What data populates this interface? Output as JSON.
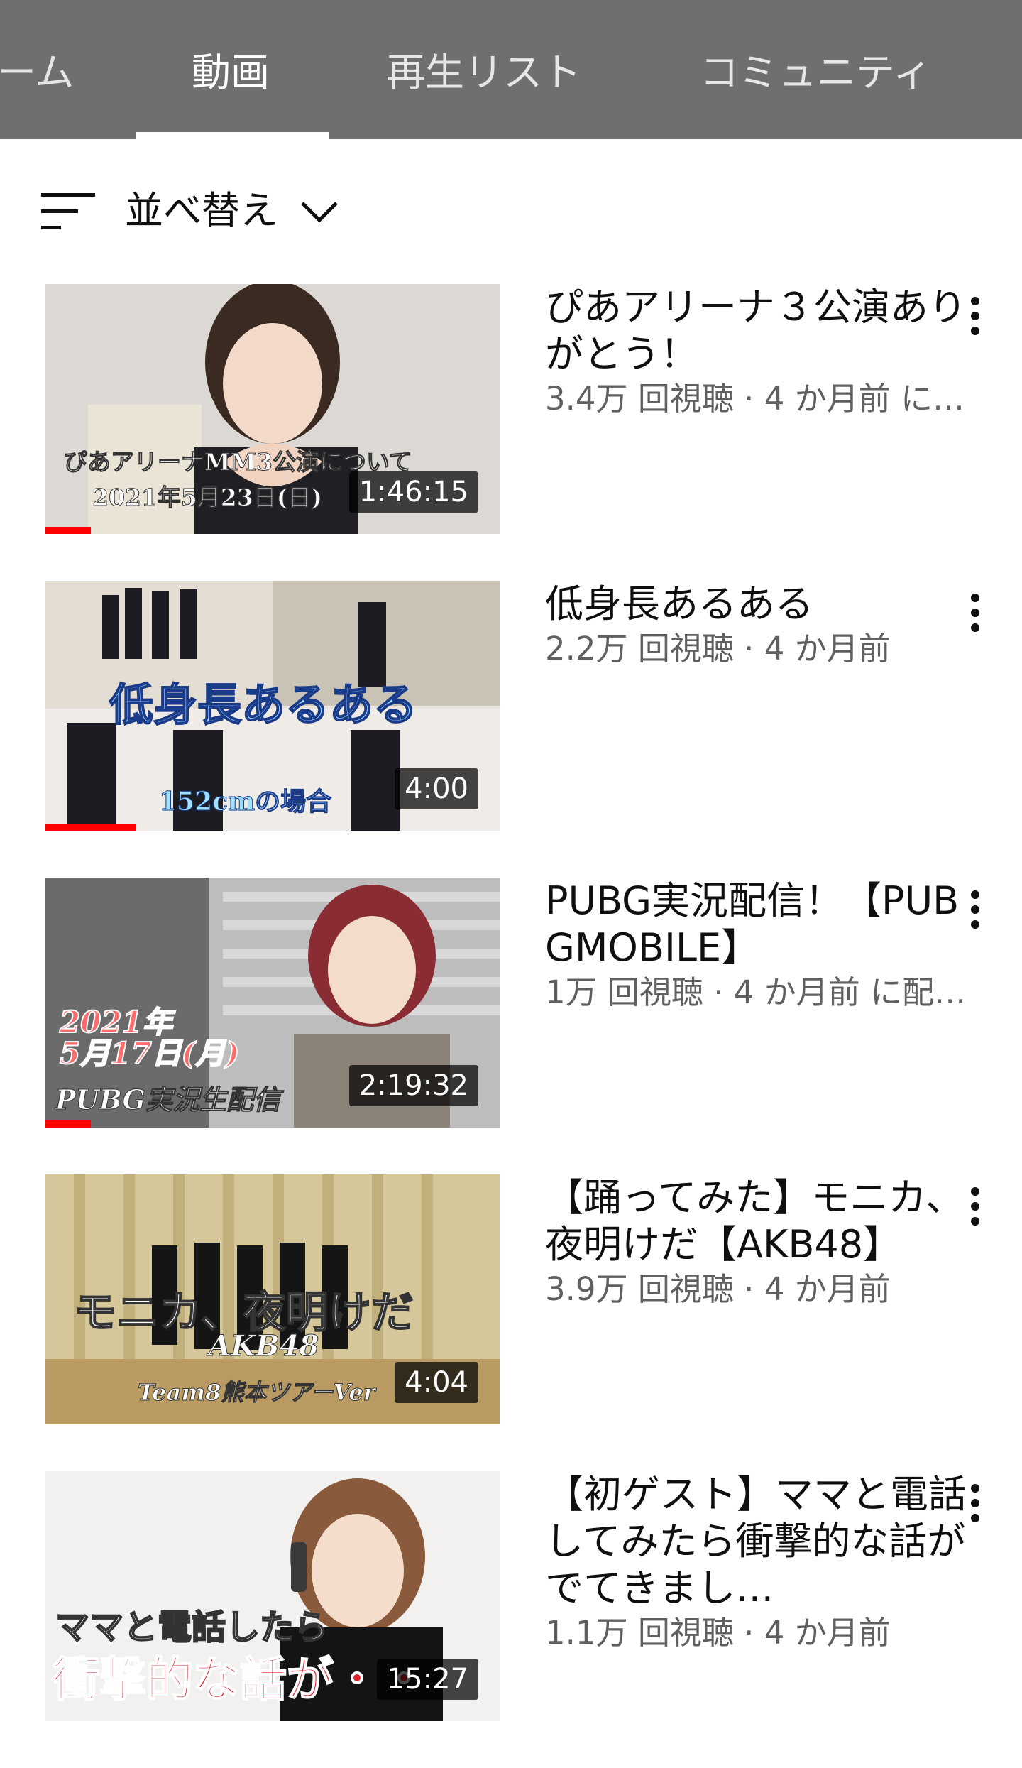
{
  "tabs": [
    {
      "label": "ーム",
      "active": false
    },
    {
      "label": "動画",
      "active": true
    },
    {
      "label": "再生リスト",
      "active": false
    },
    {
      "label": "コミュニティ",
      "active": false
    }
  ],
  "sort": {
    "label": "並べ替え",
    "icon": "sort-icon",
    "chevron": "chevron-down-icon"
  },
  "videos": [
    {
      "title": "ぴあアリーナ３公演ありがとう！",
      "meta": "3.4万 回視聴 · 4 か月前 に…",
      "duration": "1:46:15",
      "watched": 0.1,
      "overlay": [
        "ぴあアリーナMM3公演について",
        "2021年5月23日(日)"
      ]
    },
    {
      "title": "低身長あるある",
      "meta": "2.2万 回視聴 · 4 か月前",
      "duration": "4:00",
      "watched": 0.2,
      "overlay": [
        "低身長あるある",
        "152cmの場合"
      ]
    },
    {
      "title": "PUBG実況配信！【PUBGMOBILE】",
      "meta": "1万 回視聴 · 4 か月前 に配…",
      "duration": "2:19:32",
      "watched": 0.1,
      "overlay": [
        "2021年",
        "5月17日(月)",
        "PUBG実況生配信"
      ]
    },
    {
      "title": "【踊ってみた】モニカ、夜明けだ【AKB48】",
      "meta": "3.9万 回視聴 · 4 か月前",
      "duration": "4:04",
      "watched": 0,
      "overlay": [
        "モニカ、夜明けだ",
        "AKB48",
        "Team8熊本ツアーVer"
      ]
    },
    {
      "title": "【初ゲスト】ママと電話してみたら衝撃的な話がでてきまし…",
      "meta": "1.1万 回視聴 · 4 か月前",
      "duration": "15:27",
      "watched": 0,
      "overlay": [
        "ママと電話したら",
        "衝撃的な話が・・"
      ]
    }
  ],
  "icons": {
    "more": "more-vert-icon"
  },
  "colors": {
    "tabbar": "#6f6f6f",
    "progress": "#ff0000",
    "meta": "#606060"
  }
}
